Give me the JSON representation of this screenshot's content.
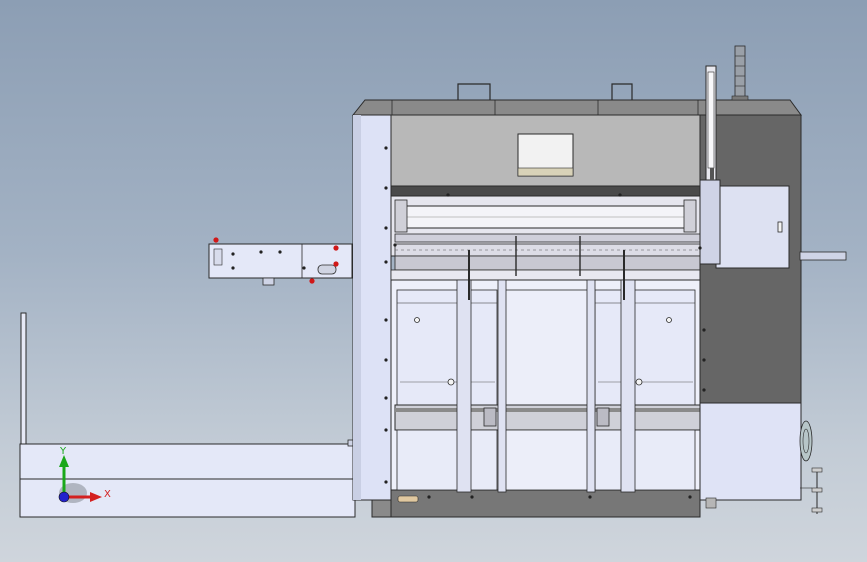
{
  "viewport": {
    "background_top": "#8c9eb4",
    "background_bottom": "#cfd5dc"
  },
  "machine": {
    "panel_fill": "#e4e8f8",
    "frame_fill": "#c9cfe2",
    "dark_housing": "#666666",
    "roof_fill": "#8a8a8a",
    "inner_fill": "#b8b8b8",
    "outline": "#2a2a2a"
  },
  "triad": {
    "y_label": "Y",
    "x_label": "X",
    "y_color": "#1aa81a",
    "x_color": "#d42020",
    "z_color": "#2222cc"
  },
  "markers": {
    "red_dot_color": "#d01818",
    "black_dot_color": "#222222"
  }
}
